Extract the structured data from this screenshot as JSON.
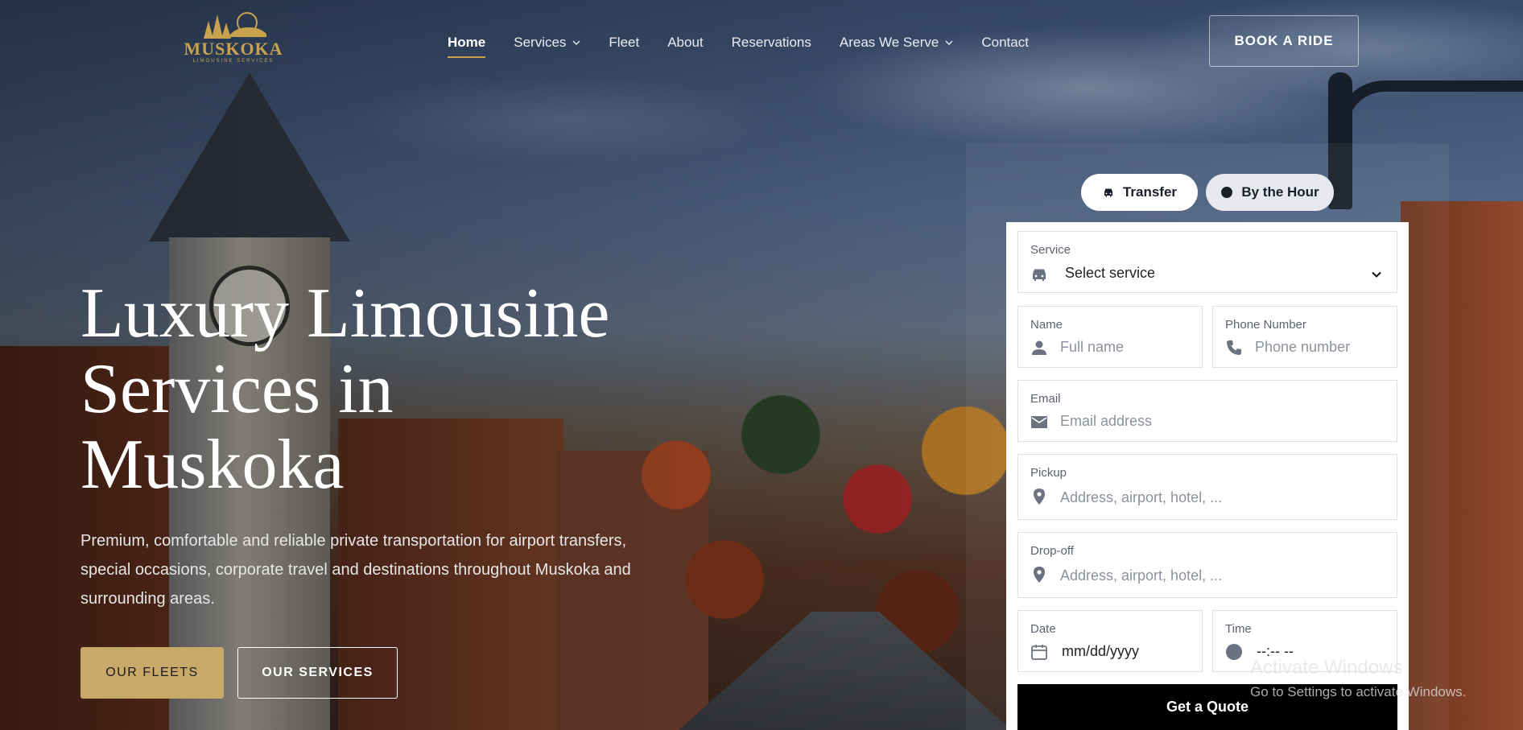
{
  "logo": {
    "name": "MUSKOKA",
    "tagline": "LIMOUSINE SERVICES",
    "color": "#c9a24e"
  },
  "nav": {
    "items": [
      {
        "label": "Home",
        "active": true
      },
      {
        "label": "Services",
        "dropdown": true
      },
      {
        "label": "Fleet"
      },
      {
        "label": "About"
      },
      {
        "label": "Reservations"
      },
      {
        "label": "Areas We Serve",
        "dropdown": true
      },
      {
        "label": "Contact"
      }
    ],
    "book_button": "BOOK A RIDE"
  },
  "hero": {
    "title": "Luxury Limousine Services in Muskoka",
    "subtitle": "Premium, comfortable and reliable private transportation for airport transfers, special occasions, corporate travel and destinations throughout Muskoka and surrounding areas.",
    "primary_button": "OUR FLEETS",
    "secondary_button": "OUR SERVICES",
    "accent_color": "#c9a96a"
  },
  "booking": {
    "tabs": [
      {
        "label": "Transfer",
        "icon": "car-icon",
        "selected": true
      },
      {
        "label": "By the Hour",
        "icon": "clock-icon",
        "selected": false
      }
    ],
    "service": {
      "label": "Service",
      "value": "Select service",
      "icon": "car-icon"
    },
    "name": {
      "label": "Name",
      "placeholder": "Full name",
      "icon": "person-icon"
    },
    "phone": {
      "label": "Phone Number",
      "placeholder": "Phone number",
      "icon": "phone-icon"
    },
    "email": {
      "label": "Email",
      "placeholder": "Email address",
      "icon": "mail-icon"
    },
    "pickup": {
      "label": "Pickup",
      "placeholder": "Address, airport, hotel, ...",
      "icon": "location-pin-icon"
    },
    "dropoff": {
      "label": "Drop-off",
      "placeholder": "Address, airport, hotel, ...",
      "icon": "location-pin-icon"
    },
    "date": {
      "label": "Date",
      "value": "mm/dd/yyyy",
      "icon": "calendar-icon"
    },
    "time": {
      "label": "Time",
      "value": "--:-- --",
      "icon": "clock-icon"
    },
    "submit": "Get a Quote"
  },
  "watermark": {
    "line1": "Activate Windows",
    "line2": "Go to Settings to activate Windows."
  }
}
